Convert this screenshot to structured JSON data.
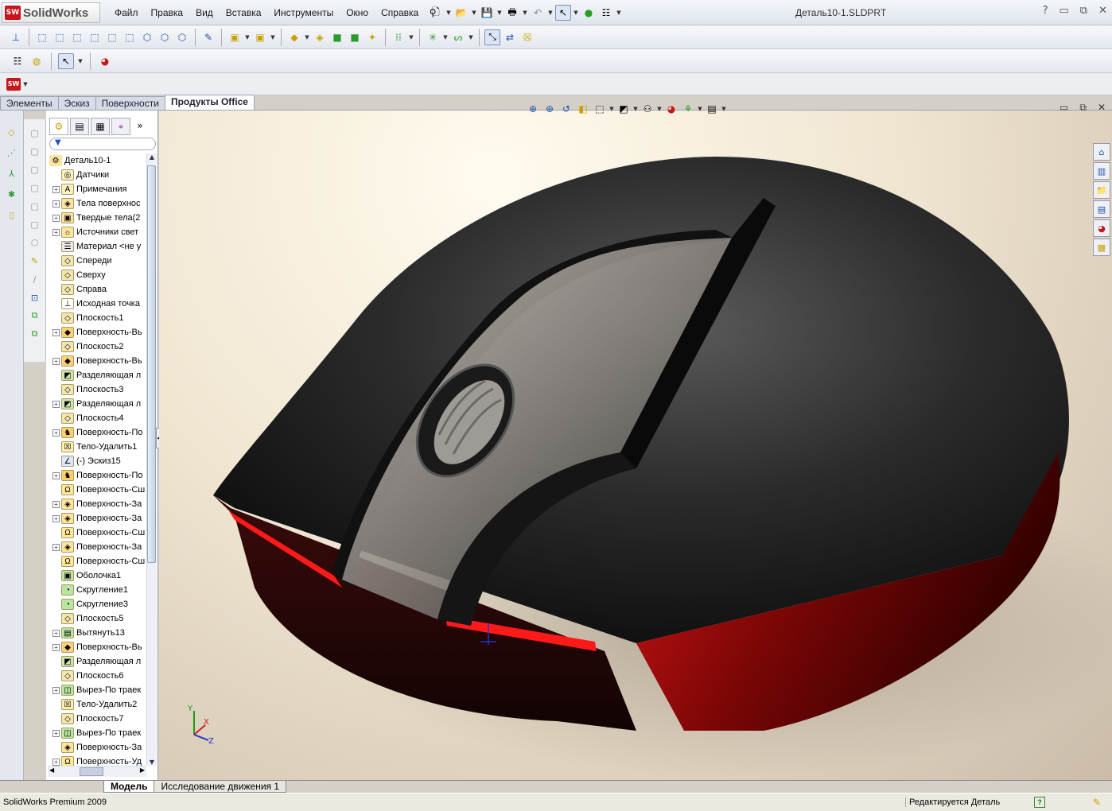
{
  "app": {
    "brand": "SolidWorks",
    "doc_title": "Деталь10-1.SLDPRT",
    "sw_badge": "SW"
  },
  "menu": [
    "Файл",
    "Правка",
    "Вид",
    "Вставка",
    "Инструменты",
    "Окно",
    "Справка"
  ],
  "window_controls": {
    "help": "?",
    "minimize": "▭",
    "restore": "⧉",
    "close": "✕"
  },
  "command_tabs": [
    "Элементы",
    "Эскиз",
    "Поверхности",
    "Продукты Office"
  ],
  "active_command_tab": "Продукты Office",
  "tree": {
    "root": "Деталь10-1",
    "items": [
      {
        "label": "Датчики",
        "exp": false,
        "icon": "sensor-icon"
      },
      {
        "label": "Примечания",
        "exp": true,
        "icon": "annotation-icon"
      },
      {
        "label": "Тела поверхнос",
        "exp": true,
        "icon": "surface-bodies-icon"
      },
      {
        "label": "Твердые тела(2",
        "exp": true,
        "icon": "solid-bodies-icon"
      },
      {
        "label": "Источники свет",
        "exp": true,
        "icon": "light-icon"
      },
      {
        "label": "Материал <не у",
        "exp": false,
        "icon": "material-icon"
      },
      {
        "label": "Спереди",
        "exp": false,
        "icon": "plane-icon"
      },
      {
        "label": "Сверху",
        "exp": false,
        "icon": "plane-icon"
      },
      {
        "label": "Справа",
        "exp": false,
        "icon": "plane-icon"
      },
      {
        "label": "Исходная точка",
        "exp": false,
        "icon": "origin-icon"
      },
      {
        "label": "Плоскость1",
        "exp": false,
        "icon": "plane-icon"
      },
      {
        "label": "Поверхность-Вь",
        "exp": true,
        "icon": "surface-extrude-icon"
      },
      {
        "label": "Плоскость2",
        "exp": false,
        "icon": "plane-icon"
      },
      {
        "label": "Поверхность-Вь",
        "exp": true,
        "icon": "surface-extrude-icon"
      },
      {
        "label": "Разделяющая л",
        "exp": false,
        "icon": "split-line-icon"
      },
      {
        "label": "Плоскость3",
        "exp": false,
        "icon": "plane-icon"
      },
      {
        "label": "Разделяющая л",
        "exp": true,
        "icon": "split-line-icon"
      },
      {
        "label": "Плоскость4",
        "exp": false,
        "icon": "plane-icon"
      },
      {
        "label": "Поверхность-По",
        "exp": true,
        "icon": "surface-loft-icon"
      },
      {
        "label": "Тело-Удалить1",
        "exp": false,
        "icon": "body-delete-icon"
      },
      {
        "label": "(-) Эскиз15",
        "exp": false,
        "icon": "sketch-icon"
      },
      {
        "label": "Поверхность-По",
        "exp": true,
        "icon": "surface-loft-icon"
      },
      {
        "label": "Поверхность-Сш",
        "exp": false,
        "icon": "surface-knit-icon"
      },
      {
        "label": "Поверхность-За",
        "exp": true,
        "icon": "surface-fill-icon"
      },
      {
        "label": "Поверхность-За",
        "exp": true,
        "icon": "surface-fill-icon"
      },
      {
        "label": "Поверхность-Сш",
        "exp": false,
        "icon": "surface-knit-icon"
      },
      {
        "label": "Поверхность-За",
        "exp": true,
        "icon": "surface-fill-icon"
      },
      {
        "label": "Поверхность-Сш",
        "exp": false,
        "icon": "surface-knit-icon"
      },
      {
        "label": "Оболочка1",
        "exp": false,
        "icon": "shell-icon"
      },
      {
        "label": "Скругление1",
        "exp": false,
        "icon": "fillet-icon"
      },
      {
        "label": "Скругление3",
        "exp": false,
        "icon": "fillet-icon"
      },
      {
        "label": "Плоскость5",
        "exp": false,
        "icon": "plane-icon"
      },
      {
        "label": "Вытянуть13",
        "exp": true,
        "icon": "extrude-icon"
      },
      {
        "label": "Поверхность-Вь",
        "exp": true,
        "icon": "surface-extrude-icon"
      },
      {
        "label": "Разделяющая л",
        "exp": false,
        "icon": "split-line-icon"
      },
      {
        "label": "Плоскость6",
        "exp": false,
        "icon": "plane-icon"
      },
      {
        "label": "Вырез-По траек",
        "exp": true,
        "icon": "sweep-cut-icon"
      },
      {
        "label": "Тело-Удалить2",
        "exp": false,
        "icon": "body-delete-icon"
      },
      {
        "label": "Плоскость7",
        "exp": false,
        "icon": "plane-icon"
      },
      {
        "label": "Вырез-По траек",
        "exp": true,
        "icon": "sweep-cut-icon"
      },
      {
        "label": "Поверхность-За",
        "exp": false,
        "icon": "surface-fill-icon"
      },
      {
        "label": "Поверхность-Уд",
        "exp": true,
        "icon": "surface-delete-icon"
      }
    ]
  },
  "bottom_tabs": [
    "Модель",
    "Исследование движения 1"
  ],
  "active_bottom_tab": "Модель",
  "status": {
    "left": "SolidWorks Premium 2009",
    "right": "Редактируется Деталь",
    "help": "?"
  },
  "triad": {
    "x": "X",
    "y": "Y",
    "z": "Z"
  },
  "colors": {
    "accent": "#c8161d",
    "selection": "#dbe5f6",
    "body_dark": "#1c1c1c",
    "body_red": "#9a0a0a"
  }
}
